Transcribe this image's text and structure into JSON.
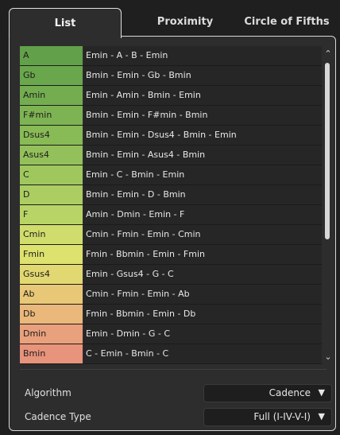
{
  "tabs": [
    {
      "label": "List"
    },
    {
      "label": "Proximity"
    },
    {
      "label": "Circle of Fifths"
    }
  ],
  "rows": [
    {
      "chord": "A",
      "progression": "Emin - A - B - Emin",
      "color": "#62a049"
    },
    {
      "chord": "Gb",
      "progression": "Bmin - Emin - Gb - Bmin",
      "color": "#6aa64c"
    },
    {
      "chord": "Amin",
      "progression": "Emin - Amin - Bmin - Emin",
      "color": "#74ad50"
    },
    {
      "chord": "F#min",
      "progression": "Bmin - Emin - F#min - Bmin",
      "color": "#7eb353"
    },
    {
      "chord": "Dsus4",
      "progression": "Bmin - Emin - Dsus4 - Bmin - Emin",
      "color": "#88ba56"
    },
    {
      "chord": "Asus4",
      "progression": "Bmin - Emin - Asus4 - Bmin",
      "color": "#93c05a"
    },
    {
      "chord": "C",
      "progression": "Emin - C - Bmin - Emin",
      "color": "#9fc75e"
    },
    {
      "chord": "D",
      "progression": "Bmin - Emin - D - Bmin",
      "color": "#abcd62"
    },
    {
      "chord": "F",
      "progression": "Amin - Dmin - Emin - F",
      "color": "#b8d466"
    },
    {
      "chord": "Cmin",
      "progression": "Cmin - Fmin - Emin - Cmin",
      "color": "#d0dd6c"
    },
    {
      "chord": "Fmin",
      "progression": "Fmin - Bbmin - Emin - Fmin",
      "color": "#dde16e"
    },
    {
      "chord": "Gsus4",
      "progression": "Emin - Gsus4 - G - C",
      "color": "#e2d872"
    },
    {
      "chord": "Ab",
      "progression": "Cmin - Fmin - Emin - Ab",
      "color": "#e8c877"
    },
    {
      "chord": "Db",
      "progression": "Fmin - Bbmin - Emin - Db",
      "color": "#e9b87a"
    },
    {
      "chord": "Dmin",
      "progression": "Emin - Dmin - G - C",
      "color": "#e9a07c"
    },
    {
      "chord": "Bmin",
      "progression": "C - Emin - Bmin - C",
      "color": "#e8937b"
    }
  ],
  "settings": {
    "algorithm_label": "Algorithm",
    "algorithm_value": "Cadence",
    "cadence_label": "Cadence Type",
    "cadence_value": "Full (I-IV-V-I)"
  },
  "scroll": {
    "thumb_fraction": 0.55
  }
}
